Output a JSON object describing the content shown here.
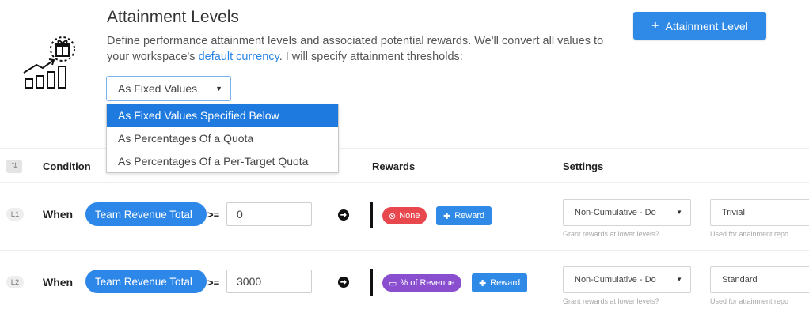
{
  "header": {
    "title": "Attainment Levels",
    "description_prefix": "Define performance attainment levels and associated potential rewards. We'll convert all values to your workspace's ",
    "description_link": "default currency",
    "description_suffix": ". I will specify attainment thresholds:",
    "add_button_label": "Attainment Level"
  },
  "threshold_select": {
    "value": "As Fixed Values",
    "options": [
      "As Fixed Values Specified Below",
      "As Percentages Of a Quota",
      "As Percentages Of a Per-Target Quota"
    ]
  },
  "columns": {
    "condition": "Condition",
    "rewards": "Rewards",
    "settings": "Settings"
  },
  "levels": [
    {
      "badge": "L1",
      "when": "When",
      "metric": "Team Revenue Total",
      "operator": ">=",
      "threshold": "0",
      "reward_tag": "None",
      "reward_button": "Reward",
      "cumulative": "Non-Cumulative - Do",
      "cumulative_help": "Grant rewards at lower levels?",
      "name": "Trivial",
      "name_help": "Used for attainment repo"
    },
    {
      "badge": "L2",
      "when": "When",
      "metric": "Team Revenue Total",
      "operator": ">=",
      "threshold": "3000",
      "reward_tag": "% of Revenue",
      "reward_button": "Reward",
      "cumulative": "Non-Cumulative - Do",
      "cumulative_help": "Grant rewards at lower levels?",
      "name": "Standard",
      "name_help": "Used for attainment repo"
    }
  ],
  "icons": {
    "logo": "gift-growth-chart-icon",
    "sort": "sort-icon",
    "arrow": "arrow-right-circle-icon",
    "none": "close-circle-icon",
    "revenue": "card-icon",
    "plus": "plus-icon",
    "caret": "caret-down-icon"
  }
}
